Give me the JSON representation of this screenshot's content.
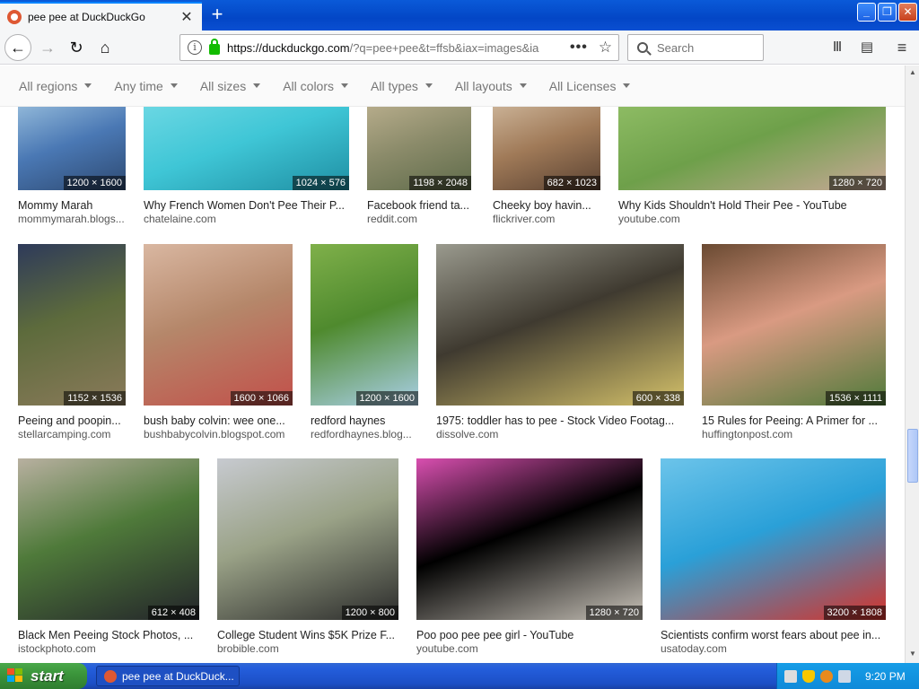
{
  "browser": {
    "tab_title": "pee pee at DuckDuckGo",
    "new_tab": "+",
    "url_host": "https://duckduckgo.com",
    "url_rest": "/?q=pee+pee&t=ffsb&iax=images&ia",
    "search_placeholder": "Search",
    "window_buttons": {
      "minimize": "_",
      "maximize": "❐",
      "close": "✕"
    }
  },
  "filters": [
    "All regions",
    "Any time",
    "All sizes",
    "All colors",
    "All types",
    "All layouts",
    "All Licenses"
  ],
  "results": [
    {
      "title": "Mommy Marah",
      "source": "mommymarah.blogs...",
      "dims": "1200 × 1600",
      "colors": [
        "#4a78b4",
        "#8fb6d8",
        "#2e4a72"
      ]
    },
    {
      "title": "Why French Women Don't Pee Their P...",
      "source": "chatelaine.com",
      "dims": "1024 × 576",
      "colors": [
        "#3fc6d6",
        "#6ad7e3",
        "#1f8fa3"
      ]
    },
    {
      "title": "Facebook friend ta...",
      "source": "reddit.com",
      "dims": "1198 × 2048",
      "colors": [
        "#8b8b6a",
        "#b5ab8a",
        "#5f6b4a"
      ]
    },
    {
      "title": "Cheeky boy havin...",
      "source": "flickriver.com",
      "dims": "682 × 1023",
      "colors": [
        "#a07a58",
        "#c9b094",
        "#5a4232"
      ]
    },
    {
      "title": "Why Kids Shouldn't Hold Their Pee - YouTube",
      "source": "youtube.com",
      "dims": "1280 × 720",
      "colors": [
        "#6ea04a",
        "#8dbb63",
        "#c9a898"
      ]
    },
    {
      "title": "Peeing and poopin...",
      "source": "stellarcamping.com",
      "dims": "1152 × 1536",
      "colors": [
        "#5d6b3c",
        "#2e3a5a",
        "#8a7a5a"
      ]
    },
    {
      "title": "bush baby colvin: wee one...",
      "source": "bushbabycolvin.blogspot.com",
      "dims": "1600 × 1066",
      "colors": [
        "#b5876a",
        "#d9b7a1",
        "#c2504a"
      ]
    },
    {
      "title": "redford haynes",
      "source": "redfordhaynes.blog...",
      "dims": "1200 × 1600",
      "colors": [
        "#4f8a2e",
        "#7fb04a",
        "#a9cfe6"
      ]
    },
    {
      "title": "1975: toddler has to pee - Stock Video Footag...",
      "source": "dissolve.com",
      "dims": "600 × 338",
      "colors": [
        "#3f3a30",
        "#9a9a8e",
        "#d4c16a"
      ]
    },
    {
      "title": "15 Rules for Peeing: A Primer for ...",
      "source": "huffingtonpost.com",
      "dims": "1536 × 1111",
      "colors": [
        "#d99a82",
        "#6a4a32",
        "#4f7a3a"
      ]
    },
    {
      "title": "Black Men Peeing Stock Photos, ...",
      "source": "istockphoto.com",
      "dims": "612 × 408",
      "colors": [
        "#4f7a3a",
        "#b8b0a0",
        "#23242a"
      ]
    },
    {
      "title": "College Student Wins $5K Prize F...",
      "source": "brobible.com",
      "dims": "1200 × 800",
      "colors": [
        "#9aa287",
        "#c7cad0",
        "#2a2a2a"
      ]
    },
    {
      "title": "Poo poo pee pee girl - YouTube",
      "source": "youtube.com",
      "dims": "1280 × 720",
      "colors": [
        "#000000",
        "#d94fb0",
        "#c8c2b8"
      ]
    },
    {
      "title": "Scientists confirm worst fears about pee in...",
      "source": "usatoday.com",
      "dims": "3200 × 1808",
      "colors": [
        "#2aa0d8",
        "#6cc4ea",
        "#d6322a"
      ]
    }
  ],
  "taskbar": {
    "start_label": "start",
    "task_title": "pee pee at DuckDuck...",
    "clock": "9:20 PM"
  }
}
